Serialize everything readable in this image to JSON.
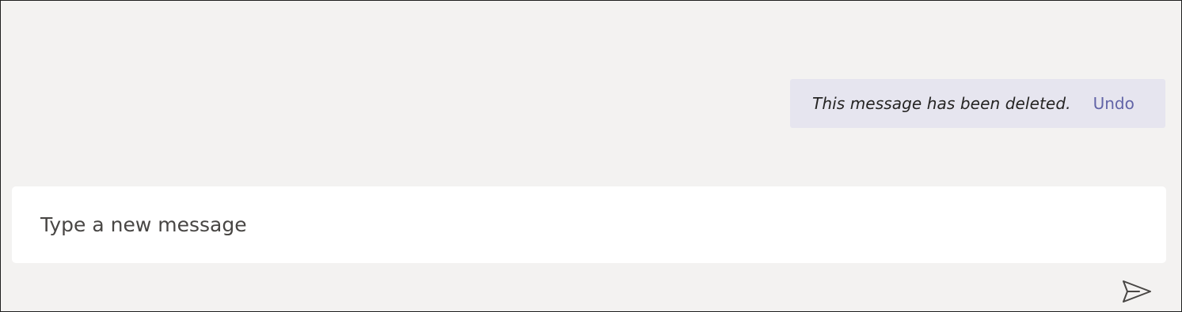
{
  "message": {
    "deleted_text": "This message has been deleted.",
    "undo_label": "Undo"
  },
  "compose": {
    "placeholder": "Type a new message",
    "value": ""
  },
  "send": {
    "icon": "send-icon"
  },
  "colors": {
    "background": "#f3f2f1",
    "notice_background": "#e6e5ef",
    "accent": "#6264a7",
    "compose_background": "#ffffff"
  }
}
